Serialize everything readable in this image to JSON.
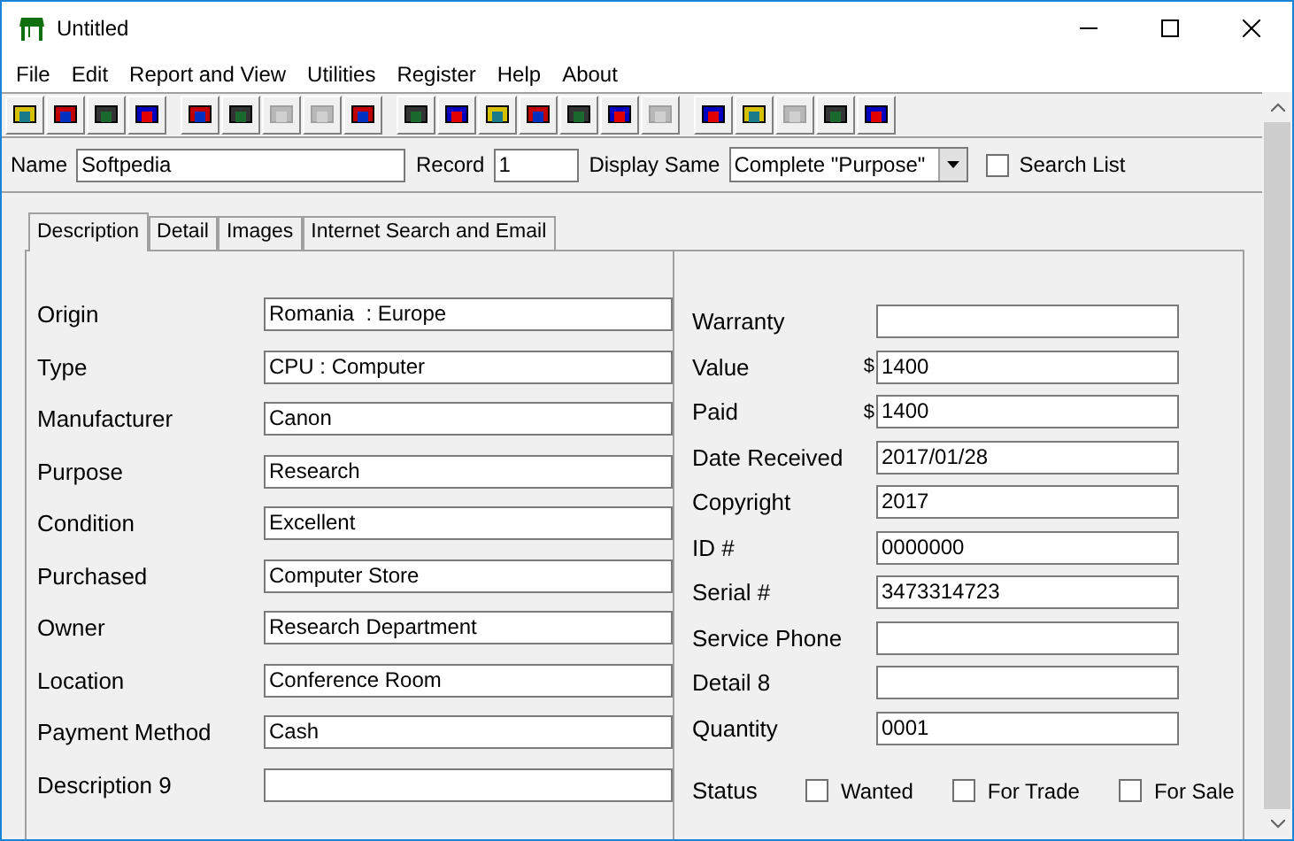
{
  "window": {
    "title": "Untitled"
  },
  "menu": [
    "File",
    "Edit",
    "Report and View",
    "Utilities",
    "Register",
    "Help",
    "About"
  ],
  "toolbar": [
    [
      {
        "disabled": false
      },
      {
        "disabled": false
      },
      {
        "disabled": false
      },
      {
        "disabled": false
      }
    ],
    [
      {
        "disabled": false
      },
      {
        "disabled": false
      },
      {
        "disabled": true
      },
      {
        "disabled": true
      },
      {
        "disabled": false
      }
    ],
    [
      {
        "disabled": false
      },
      {
        "disabled": false
      },
      {
        "disabled": false
      },
      {
        "disabled": false
      },
      {
        "disabled": false
      },
      {
        "disabled": false
      },
      {
        "disabled": true
      }
    ],
    [
      {
        "disabled": false
      },
      {
        "disabled": false
      },
      {
        "disabled": true
      },
      {
        "disabled": false
      },
      {
        "disabled": false
      }
    ]
  ],
  "record_bar": {
    "name_label": "Name",
    "name_value": "Softpedia",
    "record_label": "Record",
    "record_value": "1",
    "display_label": "Display Same",
    "display_value": "Complete \"Purpose\"",
    "search_list": {
      "label": "Search List",
      "checked": false
    }
  },
  "tabs": [
    {
      "label": "Description",
      "selected": true
    },
    {
      "label": "Detail",
      "selected": false
    },
    {
      "label": "Images",
      "selected": false
    },
    {
      "label": "Internet Search and Email",
      "selected": false
    }
  ],
  "left_fields": [
    {
      "label": "Origin",
      "value": "Romania  : Europe"
    },
    {
      "label": "Type",
      "value": "CPU : Computer"
    },
    {
      "label": "Manufacturer",
      "value": "Canon"
    },
    {
      "label": "Purpose",
      "value": "Research"
    },
    {
      "label": "Condition",
      "value": "Excellent"
    },
    {
      "label": "Purchased",
      "value": "Computer Store"
    },
    {
      "label": "Owner",
      "value": "Research Department"
    },
    {
      "label": "Location",
      "value": "Conference Room"
    },
    {
      "label": "Payment Method",
      "value": "Cash"
    },
    {
      "label": "Description 9"
    }
  ],
  "right_fields": [
    {
      "label": "Warranty"
    },
    {
      "label": "Value",
      "prefix": "$",
      "value": "1400"
    },
    {
      "label": "Paid",
      "prefix": "$",
      "value": "1400"
    },
    {
      "label": "Date Received",
      "value": "2017/01/28"
    },
    {
      "label": "Copyright",
      "value": "2017"
    },
    {
      "label": "ID #",
      "value": "0000000"
    },
    {
      "label": "Serial #",
      "value": "3473314723"
    },
    {
      "label": "Service Phone"
    },
    {
      "label": "Detail 8"
    },
    {
      "label": "Quantity",
      "value": "0001"
    }
  ],
  "status": {
    "label": "Status",
    "options": [
      {
        "label": "Wanted",
        "checked": false
      },
      {
        "label": "For Trade",
        "checked": false
      },
      {
        "label": "For Sale",
        "checked": false
      }
    ]
  }
}
